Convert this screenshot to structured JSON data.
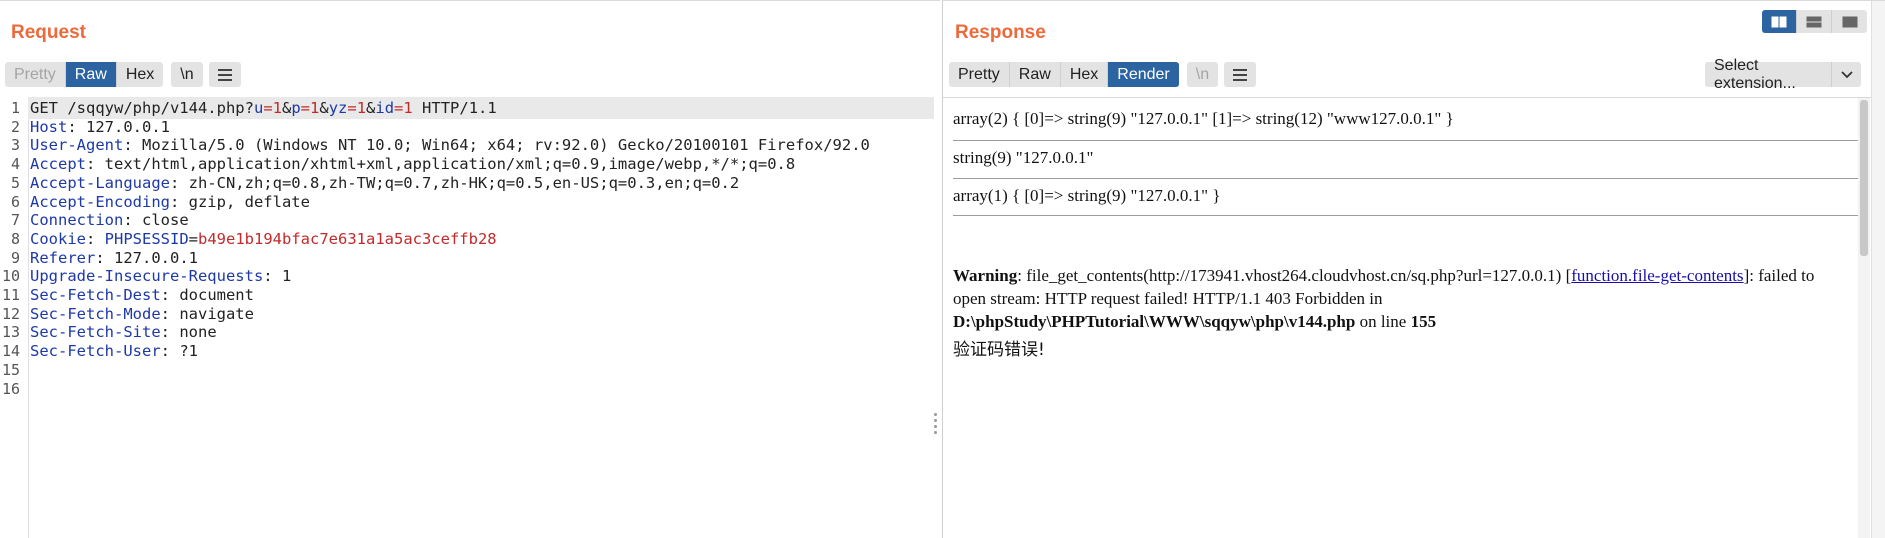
{
  "request": {
    "title": "Request",
    "tabs": [
      "Pretty",
      "Raw",
      "Hex"
    ],
    "active_tab": "Raw",
    "newline_label": "\\n",
    "lines": [
      {
        "num": "1",
        "parts": [
          [
            "plain",
            "GET /sqqyw/php/v144.php?"
          ],
          [
            "pname",
            "u"
          ],
          [
            "pval",
            "=1"
          ],
          [
            "plain",
            "&"
          ],
          [
            "pname",
            "p"
          ],
          [
            "pval",
            "=1"
          ],
          [
            "plain",
            "&"
          ],
          [
            "pname",
            "yz"
          ],
          [
            "pval",
            "=1"
          ],
          [
            "plain",
            "&"
          ],
          [
            "pname",
            "id"
          ],
          [
            "pval",
            "=1"
          ],
          [
            "plain",
            " HTTP/1.1"
          ]
        ]
      },
      {
        "num": "2",
        "parts": [
          [
            "hname",
            "Host"
          ],
          [
            "plain",
            ": 127.0.0.1"
          ]
        ]
      },
      {
        "num": "3",
        "parts": [
          [
            "hname",
            "User-Agent"
          ],
          [
            "plain",
            ": Mozilla/5.0 (Windows NT 10.0; Win64; x64; rv:92.0) Gecko/20100101 Firefox/92.0"
          ]
        ]
      },
      {
        "num": "4",
        "parts": [
          [
            "hname",
            "Accept"
          ],
          [
            "plain",
            ": text/html,application/xhtml+xml,application/xml;q=0.9,image/webp,*/*;q=0.8"
          ]
        ]
      },
      {
        "num": "5",
        "parts": [
          [
            "hname",
            "Accept-Language"
          ],
          [
            "plain",
            ": zh-CN,zh;q=0.8,zh-TW;q=0.7,zh-HK;q=0.5,en-US;q=0.3,en;q=0.2"
          ]
        ]
      },
      {
        "num": "6",
        "parts": [
          [
            "hname",
            "Accept-Encoding"
          ],
          [
            "plain",
            ": gzip, deflate"
          ]
        ]
      },
      {
        "num": "7",
        "parts": [
          [
            "hname",
            "Connection"
          ],
          [
            "plain",
            ": close"
          ]
        ]
      },
      {
        "num": "8",
        "parts": [
          [
            "hname",
            "Cookie"
          ],
          [
            "plain",
            ": "
          ],
          [
            "pname",
            "PHPSESSID"
          ],
          [
            "plain",
            "="
          ],
          [
            "cval",
            "b49e1b194bfac7e631a1a5ac3ceffb28"
          ]
        ]
      },
      {
        "num": "9",
        "parts": [
          [
            "hname",
            "Referer"
          ],
          [
            "plain",
            ": 127.0.0.1"
          ]
        ]
      },
      {
        "num": "10",
        "parts": [
          [
            "hname",
            "Upgrade-Insecure-Requests"
          ],
          [
            "plain",
            ": 1"
          ]
        ]
      },
      {
        "num": "11",
        "parts": [
          [
            "hname",
            "Sec-Fetch-Dest"
          ],
          [
            "plain",
            ": document"
          ]
        ]
      },
      {
        "num": "12",
        "parts": [
          [
            "hname",
            "Sec-Fetch-Mode"
          ],
          [
            "plain",
            ": navigate"
          ]
        ]
      },
      {
        "num": "13",
        "parts": [
          [
            "hname",
            "Sec-Fetch-Site"
          ],
          [
            "plain",
            ": none"
          ]
        ]
      },
      {
        "num": "14",
        "parts": [
          [
            "hname",
            "Sec-Fetch-User"
          ],
          [
            "plain",
            ": ?1"
          ]
        ]
      },
      {
        "num": "15",
        "parts": []
      },
      {
        "num": "16",
        "parts": []
      }
    ]
  },
  "response": {
    "title": "Response",
    "tabs": [
      "Pretty",
      "Raw",
      "Hex",
      "Render"
    ],
    "active_tab": "Render",
    "newline_label": "\\n",
    "select_extension": "Select extension...",
    "render": {
      "line1": "array(2) { [0]=> string(9) \"127.0.0.1\" [1]=> string(12) \"www127.0.0.1\" }",
      "line2": "string(9) \"127.0.0.1\"",
      "line3": "array(1) { [0]=> string(9) \"127.0.0.1\" }",
      "warning_label": "Warning",
      "warning_text1": ": file_get_contents(http://173941.vhost264.cloudvhost.cn/sq.php?url=127.0.0.1) [",
      "warning_link": "function.file-get-contents",
      "warning_text2": "]: failed to open stream: HTTP request failed! HTTP/1.1 403 Forbidden in",
      "warning_path": "D:\\phpStudy\\PHPTutorial\\WWW\\sqqyw\\php\\v144.php",
      "warning_on_line": " on line ",
      "warning_line_no": "155",
      "message": "验证码错误!"
    }
  },
  "colors": {
    "accent_title": "#ec6a3c",
    "active_tab": "#2b64a0",
    "header_name": "#1d39a8",
    "param_value": "#c22a2a"
  }
}
